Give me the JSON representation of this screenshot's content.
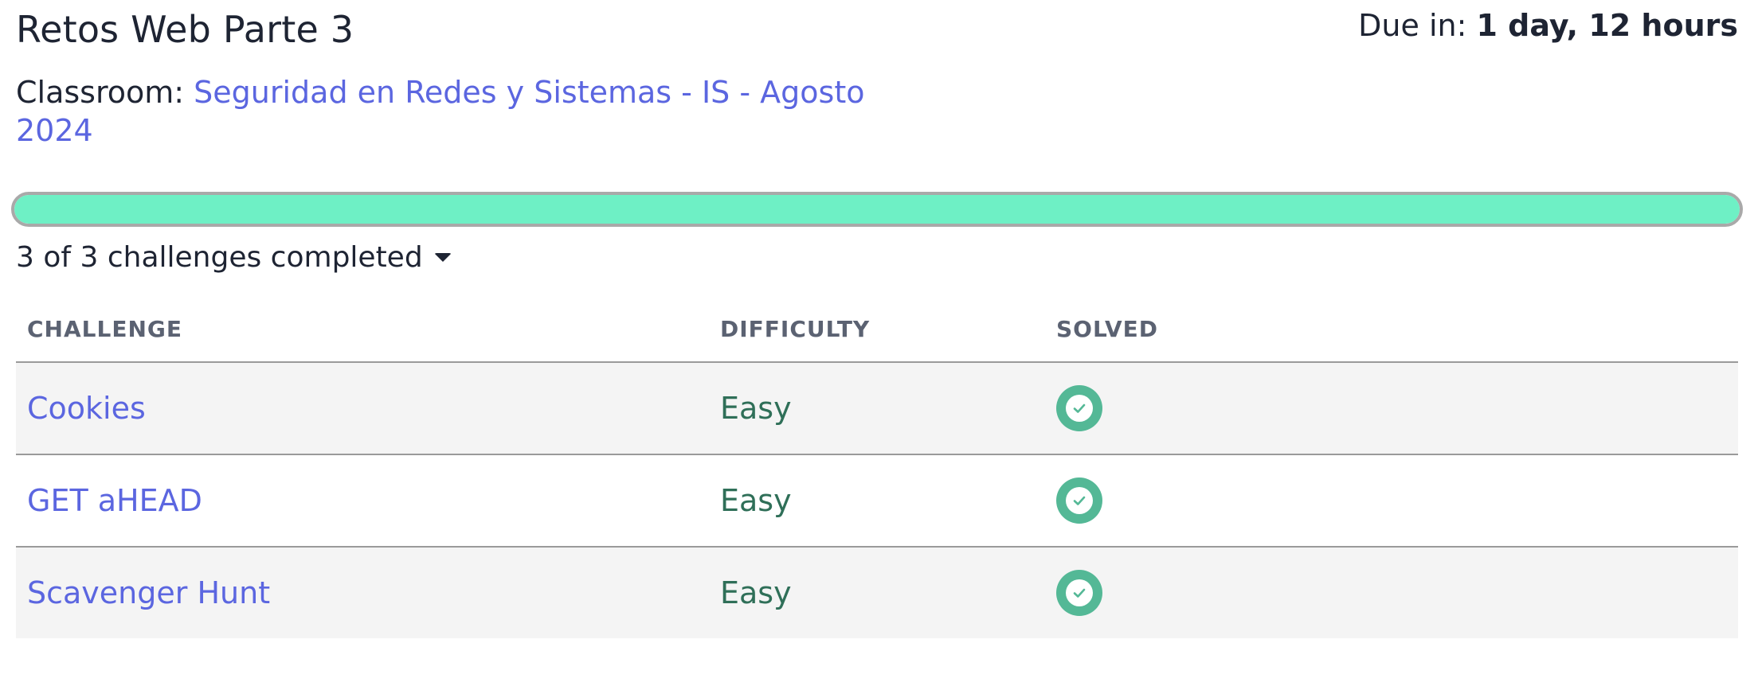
{
  "assignment": {
    "title": "Retos Web Parte 3",
    "due_label": "Due in:",
    "due_value": "1 day, 12 hours",
    "classroom_label": "Classroom:",
    "classroom_name": "Seguridad en Redes y Sistemas - IS - Agosto 2024"
  },
  "progress": {
    "completed_fraction": 1.0,
    "fill_color": "#6ef0c5",
    "summary": "3 of 3 challenges completed"
  },
  "table": {
    "headers": {
      "challenge": "CHALLENGE",
      "difficulty": "DIFFICULTY",
      "solved": "SOLVED"
    },
    "rows": [
      {
        "challenge": "Cookies",
        "difficulty": "Easy",
        "solved_icon": "check-circle-icon"
      },
      {
        "challenge": "GET aHEAD",
        "difficulty": "Easy",
        "solved_icon": "check-circle-icon"
      },
      {
        "challenge": "Scavenger Hunt",
        "difficulty": "Easy",
        "solved_icon": "check-circle-icon"
      }
    ]
  },
  "colors": {
    "link": "#5b66e0",
    "difficulty_text": "#2f6f58",
    "solved_icon": "#54b896"
  }
}
